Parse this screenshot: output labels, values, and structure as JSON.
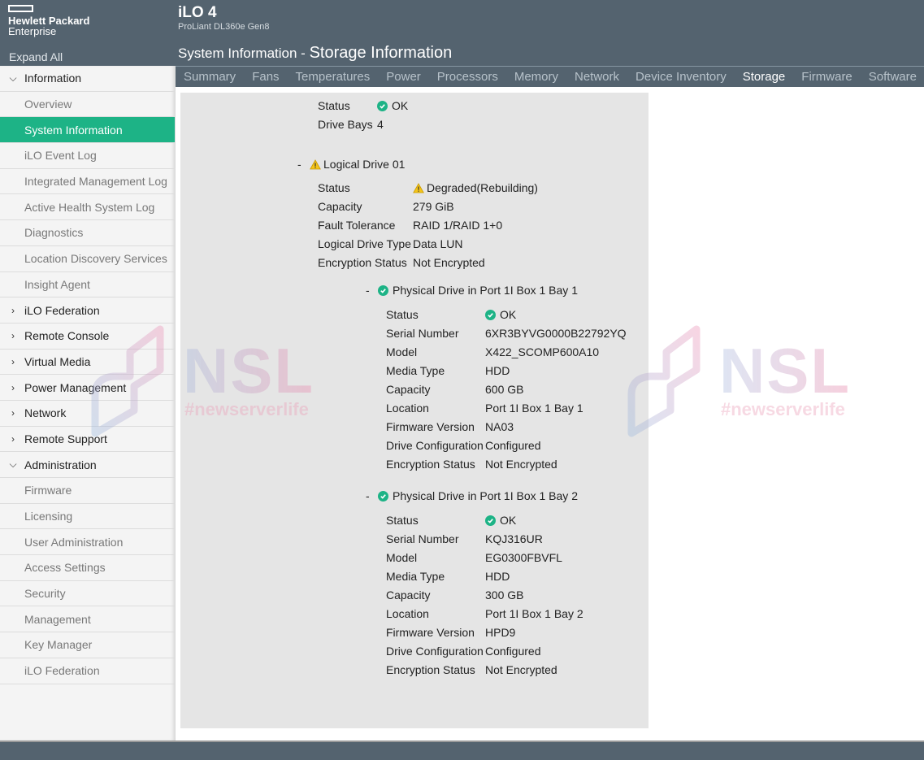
{
  "header": {
    "brand_line1": "Hewlett Packard",
    "brand_line2": "Enterprise",
    "expand_all": "Expand All",
    "product": "iLO 4",
    "server_model": "ProLiant DL360e Gen8",
    "breadcrumb_parent": "System Information - ",
    "breadcrumb_current": "Storage Information"
  },
  "tabs": [
    {
      "label": "Summary",
      "active": false
    },
    {
      "label": "Fans",
      "active": false
    },
    {
      "label": "Temperatures",
      "active": false
    },
    {
      "label": "Power",
      "active": false
    },
    {
      "label": "Processors",
      "active": false
    },
    {
      "label": "Memory",
      "active": false
    },
    {
      "label": "Network",
      "active": false
    },
    {
      "label": "Device Inventory",
      "active": false
    },
    {
      "label": "Storage",
      "active": true
    },
    {
      "label": "Firmware",
      "active": false
    },
    {
      "label": "Software",
      "active": false
    }
  ],
  "sidebar": {
    "items": [
      {
        "label": "Information",
        "type": "section",
        "expanded": true
      },
      {
        "label": "Overview",
        "type": "sub"
      },
      {
        "label": "System Information",
        "type": "sub",
        "active": true
      },
      {
        "label": "iLO Event Log",
        "type": "sub"
      },
      {
        "label": "Integrated Management Log",
        "type": "sub"
      },
      {
        "label": "Active Health System Log",
        "type": "sub"
      },
      {
        "label": "Diagnostics",
        "type": "sub"
      },
      {
        "label": "Location Discovery Services",
        "type": "sub"
      },
      {
        "label": "Insight Agent",
        "type": "sub"
      },
      {
        "label": "iLO Federation",
        "type": "section",
        "expanded": false
      },
      {
        "label": "Remote Console",
        "type": "section",
        "expanded": false
      },
      {
        "label": "Virtual Media",
        "type": "section",
        "expanded": false
      },
      {
        "label": "Power Management",
        "type": "section",
        "expanded": false
      },
      {
        "label": "Network",
        "type": "section",
        "expanded": false
      },
      {
        "label": "Remote Support",
        "type": "section",
        "expanded": false
      },
      {
        "label": "Administration",
        "type": "section",
        "expanded": true
      },
      {
        "label": "Firmware",
        "type": "sub"
      },
      {
        "label": "Licensing",
        "type": "sub"
      },
      {
        "label": "User Administration",
        "type": "sub"
      },
      {
        "label": "Access Settings",
        "type": "sub"
      },
      {
        "label": "Security",
        "type": "sub"
      },
      {
        "label": "Management",
        "type": "sub"
      },
      {
        "label": "Key Manager",
        "type": "sub"
      },
      {
        "label": "iLO Federation",
        "type": "sub"
      }
    ]
  },
  "controller": {
    "status_label": "Status",
    "status_value": "OK",
    "drive_bays_label": "Drive Bays",
    "drive_bays_value": "4"
  },
  "logical_drive": {
    "toggle": "-",
    "title": "Logical Drive 01",
    "props": [
      {
        "label": "Status",
        "value": "Degraded(Rebuilding)",
        "icon": "warning"
      },
      {
        "label": "Capacity",
        "value": "279 GiB"
      },
      {
        "label": "Fault Tolerance",
        "value": "RAID 1/RAID 1+0"
      },
      {
        "label": "Logical Drive Type",
        "value": "Data LUN"
      },
      {
        "label": "Encryption Status",
        "value": "Not Encrypted"
      }
    ]
  },
  "physical_drives": [
    {
      "toggle": "-",
      "title": "Physical Drive in Port 1I Box 1 Bay 1",
      "props": [
        {
          "label": "Status",
          "value": "OK",
          "icon": "ok"
        },
        {
          "label": "Serial Number",
          "value": "6XR3BYVG0000B22792YQ"
        },
        {
          "label": "Model",
          "value": "X422_SCOMP600A10"
        },
        {
          "label": "Media Type",
          "value": "HDD"
        },
        {
          "label": "Capacity",
          "value": "600 GB"
        },
        {
          "label": "Location",
          "value": "Port 1I Box 1 Bay 1"
        },
        {
          "label": "Firmware Version",
          "value": "NA03"
        },
        {
          "label": "Drive Configuration",
          "value": "Configured"
        },
        {
          "label": "Encryption Status",
          "value": "Not Encrypted"
        }
      ]
    },
    {
      "toggle": "-",
      "title": "Physical Drive in Port 1I Box 1 Bay 2",
      "props": [
        {
          "label": "Status",
          "value": "OK",
          "icon": "ok"
        },
        {
          "label": "Serial Number",
          "value": "KQJ316UR"
        },
        {
          "label": "Model",
          "value": "EG0300FBVFL"
        },
        {
          "label": "Media Type",
          "value": "HDD"
        },
        {
          "label": "Capacity",
          "value": "300 GB"
        },
        {
          "label": "Location",
          "value": "Port 1I Box 1 Bay 2"
        },
        {
          "label": "Firmware Version",
          "value": "HPD9"
        },
        {
          "label": "Drive Configuration",
          "value": "Configured"
        },
        {
          "label": "Encryption Status",
          "value": "Not Encrypted"
        }
      ]
    }
  ],
  "watermark": {
    "logo_text": "NSL",
    "tagline": "#newserverlife"
  },
  "colors": {
    "header_bg": "#54636f",
    "accent_green": "#1db386",
    "warning_yellow": "#f5c518",
    "panel_bg": "#e5e5e5"
  }
}
